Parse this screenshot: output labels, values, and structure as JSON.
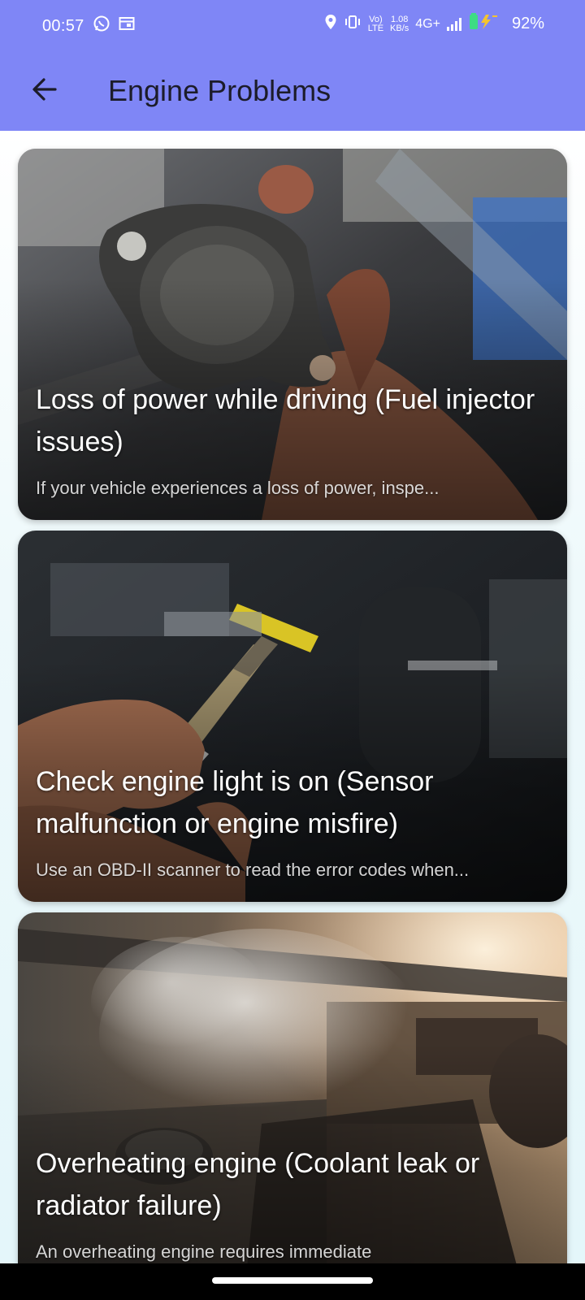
{
  "status_bar": {
    "time": "00:57",
    "net_speed_value": "1.08",
    "net_speed_unit": "KB/s",
    "volte_label_1": "Vo)",
    "volte_label_2": "LTE",
    "network": "4G+",
    "battery": "92%",
    "icons": [
      "whatsapp-icon",
      "calendar-icon",
      "location-icon",
      "vibrate-icon",
      "signal-icon",
      "battery-charging-icon"
    ]
  },
  "app_bar": {
    "title": "Engine Problems",
    "back_icon": "arrow-left-icon",
    "background": "#7f86f6"
  },
  "cards": [
    {
      "title": "Loss of power while driving (Fuel injector issues)",
      "description": "If your vehicle experiences a loss of power, inspe..."
    },
    {
      "title": "Check engine light is on (Sensor malfunction or engine misfire)",
      "description": "Use an OBD-II scanner to read the error codes when..."
    },
    {
      "title": "Overheating engine (Coolant leak or radiator failure)",
      "description": "An overheating engine requires immediate"
    }
  ]
}
